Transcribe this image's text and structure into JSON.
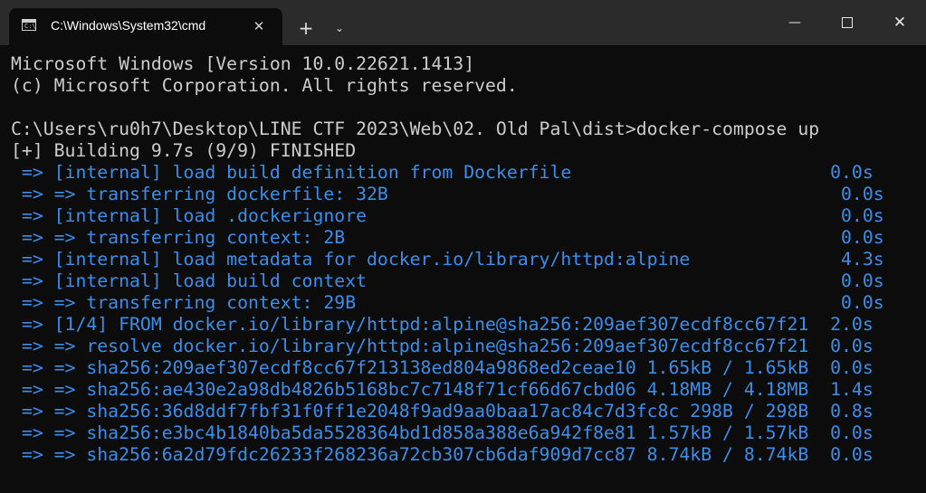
{
  "window": {
    "tab_title": "C:\\Windows\\System32\\cmd",
    "tab_icon_text": "C:\\",
    "tab_close_glyph": "✕",
    "new_tab_glyph": "+",
    "dropdown_glyph": "⌄",
    "minimize_glyph": "—",
    "close_glyph": "✕"
  },
  "colors": {
    "terminal_background": "#0c0c0c",
    "titlebar_background": "#2b2b2b",
    "default_text": "#cccccc",
    "build_output_text": "#3b8eea"
  },
  "terminal": {
    "lines": [
      {
        "text": "Microsoft Windows [Version 10.0.22621.1413]",
        "color": "white"
      },
      {
        "text": "(c) Microsoft Corporation. All rights reserved.",
        "color": "white"
      },
      {
        "text": "",
        "color": "white"
      },
      {
        "text": "C:\\Users\\ru0h7\\Desktop\\LINE CTF 2023\\Web\\02. Old Pal\\dist>docker-compose up",
        "color": "white"
      },
      {
        "text": "[+] Building 9.7s (9/9) FINISHED",
        "color": "white"
      },
      {
        "text": " => [internal] load build definition from Dockerfile                        0.0s",
        "color": "blue"
      },
      {
        "text": " => => transferring dockerfile: 32B                                          0.0s",
        "color": "blue"
      },
      {
        "text": " => [internal] load .dockerignore                                            0.0s",
        "color": "blue"
      },
      {
        "text": " => => transferring context: 2B                                              0.0s",
        "color": "blue"
      },
      {
        "text": " => [internal] load metadata for docker.io/library/httpd:alpine              4.3s",
        "color": "blue"
      },
      {
        "text": " => [internal] load build context                                            0.0s",
        "color": "blue"
      },
      {
        "text": " => => transferring context: 29B                                             0.0s",
        "color": "blue"
      },
      {
        "text": " => [1/4] FROM docker.io/library/httpd:alpine@sha256:209aef307ecdf8cc67f21  2.0s",
        "color": "blue"
      },
      {
        "text": " => => resolve docker.io/library/httpd:alpine@sha256:209aef307ecdf8cc67f21  0.0s",
        "color": "blue"
      },
      {
        "text": " => => sha256:209aef307ecdf8cc67f213138ed804a9868ed2ceae10 1.65kB / 1.65kB  0.0s",
        "color": "blue"
      },
      {
        "text": " => => sha256:ae430e2a98db4826b5168bc7c7148f71cf66d67cbd06 4.18MB / 4.18MB  1.4s",
        "color": "blue"
      },
      {
        "text": " => => sha256:36d8ddf7fbf31f0ff1e2048f9ad9aa0baa17ac84c7d3fc8c 298B / 298B  0.8s",
        "color": "blue"
      },
      {
        "text": " => => sha256:e3bc4b1840ba5da5528364bd1d858a388e6a942f8e81 1.57kB / 1.57kB  0.0s",
        "color": "blue"
      },
      {
        "text": " => => sha256:6a2d79fdc26233f268236a72cb307cb6daf909d7cc87 8.74kB / 8.74kB  0.0s",
        "color": "blue"
      }
    ]
  }
}
